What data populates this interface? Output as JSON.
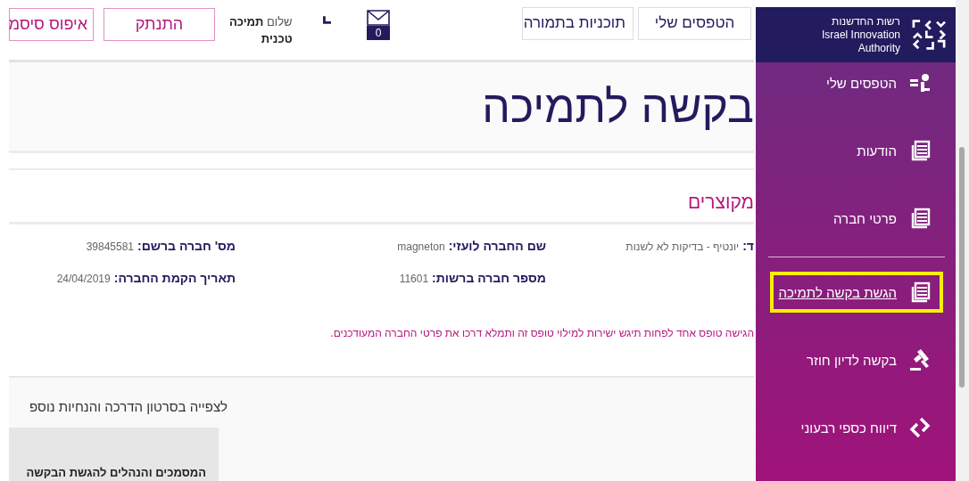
{
  "header": {
    "nav_buttons": [
      {
        "label": "הטפסים שלי"
      },
      {
        "label": "תוכניות בתמורה"
      }
    ],
    "messages": {
      "count": "0"
    },
    "greeting": "שלום **תמיכה טכנית**",
    "account_buttons": [
      {
        "label": "התנתק"
      },
      {
        "label": "איפוס סיסמ"
      }
    ]
  },
  "page_title": "בקשה לתמיכה",
  "section": {
    "title": "מקוצרים",
    "columns": [
      [
        {
          "label": "ד:",
          "value": "יונטיף - בדיקות לא לשנות"
        }
      ],
      [
        {
          "label": "שם החברה לועזי:",
          "value": "magneton"
        },
        {
          "label": "מספר חברה ברשות:",
          "value": "11601"
        }
      ],
      [
        {
          "label": "מס' חברה ברשם:",
          "value": "39845581"
        },
        {
          "label": "תאריך הקמת החברה:",
          "value": "24/04/2019"
        }
      ]
    ]
  },
  "notice": "הגישה טופס אחד לפחות תיגש ישירות למילוי טופס זה ותמלא דרכו את פרטי החברה המעודכנים.",
  "help_text": "לצפייה בסרטון הדרכה והנחיות נוספ",
  "docs_box": {
    "title": "המסמכים והנהלים להגשת הבקשה"
  },
  "sidebar": {
    "logo": {
      "lines": [
        "רשות החדשנות",
        "Israel Innovation",
        "Authority"
      ]
    },
    "groups": [
      [
        {
          "label": "הטפסים שלי",
          "kind": "forms",
          "selected": false
        },
        {
          "label": "הודעות",
          "kind": "document",
          "selected": false
        },
        {
          "label": "פרטי חברה",
          "kind": "document",
          "selected": false
        }
      ],
      [
        {
          "label": "הגשת בקשה לתמיכה",
          "kind": "document",
          "selected": true
        },
        {
          "label": "בקשה לדיון חוזר",
          "kind": "appeal",
          "selected": false
        },
        {
          "label": "דיווח כספי רבעוני",
          "kind": "report",
          "selected": false
        }
      ]
    ]
  }
}
